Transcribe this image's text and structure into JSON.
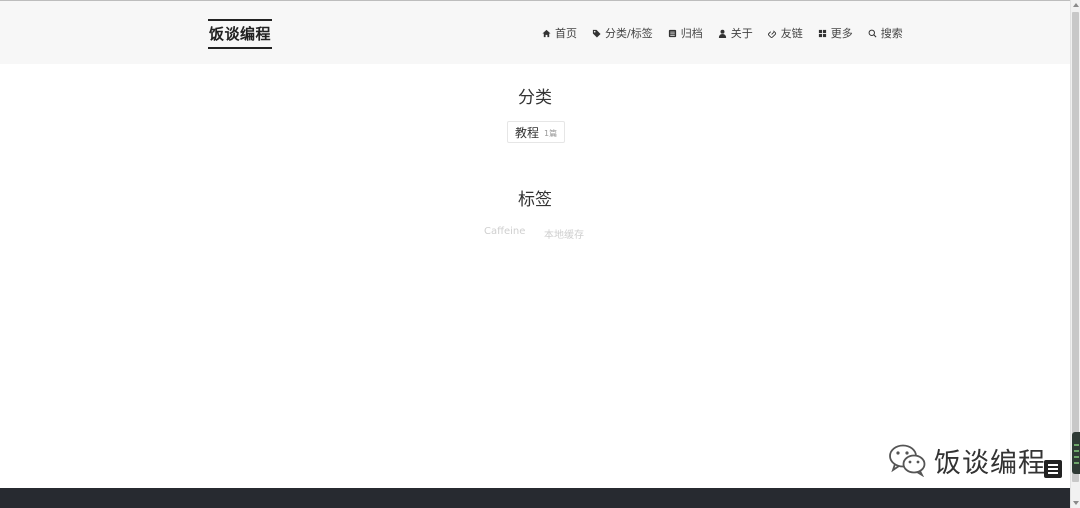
{
  "header": {
    "logo": "饭谈编程",
    "nav": [
      {
        "icon": "home-icon",
        "label": "首页"
      },
      {
        "icon": "tag-icon",
        "label": "分类/标签"
      },
      {
        "icon": "archive-icon",
        "label": "归档"
      },
      {
        "icon": "user-icon",
        "label": "关于"
      },
      {
        "icon": "link-icon",
        "label": "友链"
      },
      {
        "icon": "grid-icon",
        "label": "更多"
      },
      {
        "icon": "search-icon",
        "label": "搜索"
      }
    ]
  },
  "categories": {
    "title": "分类",
    "items": [
      {
        "name": "教程",
        "count": "1篇"
      }
    ]
  },
  "tags": {
    "title": "标签",
    "items": [
      "Caffeine",
      "本地缓存"
    ]
  },
  "watermark": {
    "icon": "wechat-icon",
    "text": "饭谈编程"
  },
  "colors": {
    "footer": "#272a30",
    "header_bg": "#f7f7f7",
    "tag_text": "#cfcfcf"
  }
}
